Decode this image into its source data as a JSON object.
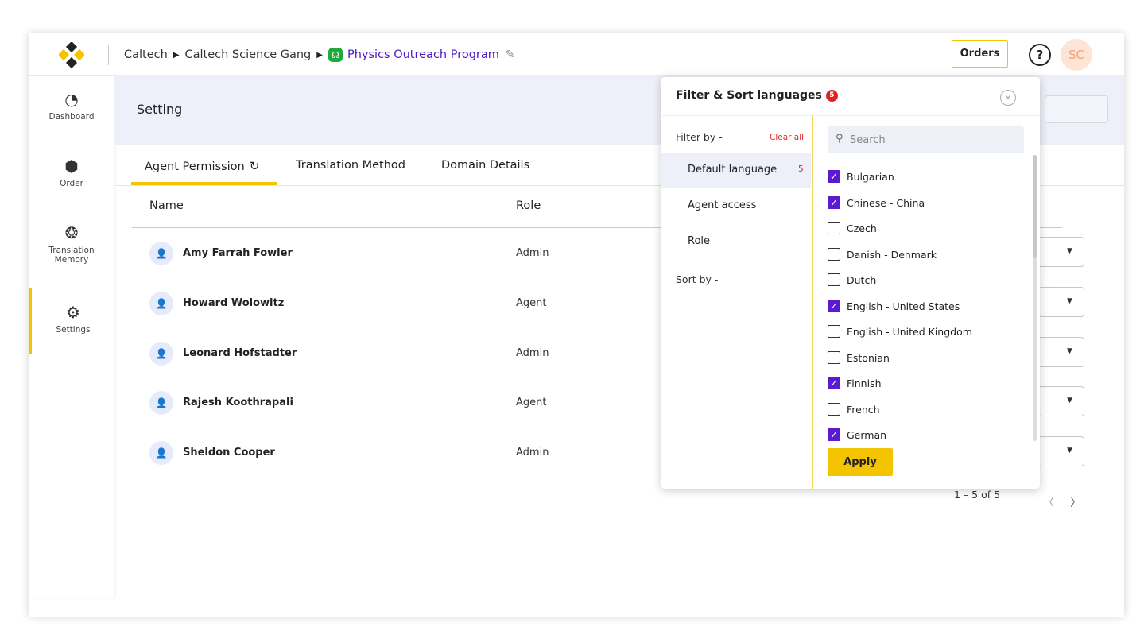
{
  "header": {
    "breadcrumb": [
      "Caltech",
      "Caltech Science Gang",
      "Physics Outreach Program"
    ],
    "orders_label": "Orders",
    "help_icon": "?",
    "user_initials": "SC"
  },
  "sidebar": {
    "items": [
      {
        "label": "Dashboard",
        "icon": "pie-chart-icon"
      },
      {
        "label": "Order",
        "icon": "box-icon"
      },
      {
        "label": "Translation Memory",
        "icon": "brain-icon"
      },
      {
        "label": "Settings",
        "icon": "gear-icon"
      }
    ],
    "active": "Settings"
  },
  "page": {
    "title": "Setting"
  },
  "tabs": [
    {
      "label": "Agent Permission"
    },
    {
      "label": "Translation Method"
    },
    {
      "label": "Domain Details"
    }
  ],
  "table": {
    "columns": [
      "Name",
      "Role"
    ],
    "rows": [
      {
        "name": "Amy Farrah Fowler",
        "role": "Admin"
      },
      {
        "name": "Howard Wolowitz",
        "role": "Agent"
      },
      {
        "name": "Leonard Hofstadter",
        "role": "Admin"
      },
      {
        "name": "Rajesh Koothrapali",
        "role": "Agent"
      },
      {
        "name": "Sheldon Cooper",
        "role": "Admin"
      }
    ],
    "pagination": "1 – 5 of 5"
  },
  "filter_popup": {
    "title": "Filter & Sort languages",
    "count": "5",
    "filter_by_label": "Filter by -",
    "clear_all": "Clear all",
    "options": [
      {
        "label": "Default language",
        "count": "5"
      },
      {
        "label": "Agent access"
      },
      {
        "label": "Role"
      }
    ],
    "sort_by_label": "Sort by -",
    "search_placeholder": "Search",
    "languages": [
      {
        "name": "Bulgarian",
        "checked": true
      },
      {
        "name": "Chinese - China",
        "checked": true
      },
      {
        "name": "Czech",
        "checked": false
      },
      {
        "name": "Danish - Denmark",
        "checked": false
      },
      {
        "name": "Dutch",
        "checked": false
      },
      {
        "name": "English - United States",
        "checked": true
      },
      {
        "name": "English - United Kingdom",
        "checked": false
      },
      {
        "name": "Estonian",
        "checked": false
      },
      {
        "name": "Finnish",
        "checked": true
      },
      {
        "name": "French",
        "checked": false
      },
      {
        "name": "German",
        "checked": true
      }
    ],
    "apply_label": "Apply"
  },
  "colors": {
    "accent": "#f5c400",
    "checkbox": "#5a1bd0",
    "link": "#4a17c9",
    "badge": "#e51e1e"
  }
}
